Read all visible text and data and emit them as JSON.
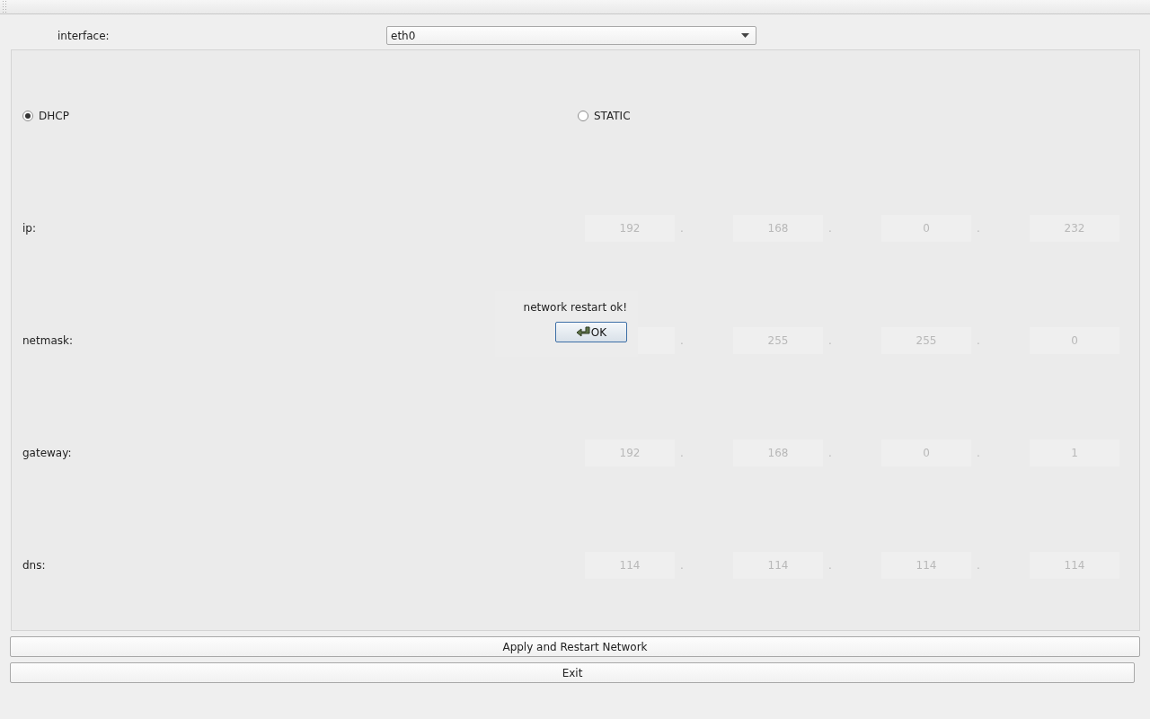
{
  "interface": {
    "label": "interface:",
    "value": "eth0"
  },
  "modes": [
    {
      "label": "DHCP",
      "selected": true
    },
    {
      "label": "STATIC",
      "selected": false
    }
  ],
  "fields_disabled": true,
  "rows": [
    {
      "label": "ip:",
      "octets": [
        {
          "value": "192"
        },
        {
          "value": "168"
        },
        {
          "value": "0"
        },
        {
          "value": "232"
        }
      ],
      "separators": [
        ".",
        ".",
        "."
      ]
    },
    {
      "label": "netmask:",
      "octets": [
        {
          "covered": true
        },
        {
          "value": "255"
        },
        {
          "value": "255"
        },
        {
          "value": "0"
        }
      ],
      "separators": [
        ".",
        ".",
        "."
      ]
    },
    {
      "label": "gateway:",
      "octets": [
        {
          "value": "192"
        },
        {
          "value": "168"
        },
        {
          "value": "0"
        },
        {
          "value": "1"
        }
      ],
      "separators": [
        ".",
        ".",
        "."
      ]
    },
    {
      "label": "dns:",
      "octets": [
        {
          "value": "114"
        },
        {
          "value": "114"
        },
        {
          "value": "114"
        },
        {
          "value": "114"
        }
      ],
      "separators": [
        ".",
        ".",
        "."
      ]
    }
  ],
  "buttons": [
    "Apply and Restart Network",
    "Exit"
  ],
  "dialog": {
    "message": "network restart ok!",
    "button": "OK"
  }
}
